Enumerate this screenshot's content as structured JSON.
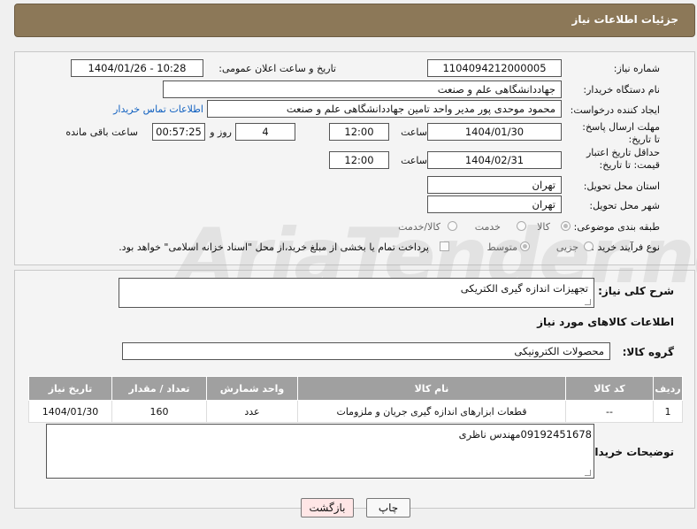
{
  "header": {
    "title": "جزئیات اطلاعات نیاز"
  },
  "fields": {
    "need_number_label": "شماره نیاز:",
    "need_number": "1104094212000005",
    "announce_label": "تاریخ و ساعت اعلان عمومی:",
    "announce_value": "1404/01/26 - 10:28",
    "buyer_label": "نام دستگاه خریدار:",
    "buyer_value": "جهاددانشگاهی علم و صنعت",
    "creator_label": "ایجاد کننده درخواست:",
    "creator_value": "محمود موحدی پور مدیر واحد تامین جهاددانشگاهی علم و صنعت",
    "contact_link": "اطلاعات تماس خریدار",
    "deadline_label": "مهلت ارسال پاسخ: تا تاریخ:",
    "deadline_date": "1404/01/30",
    "time_label": "ساعت",
    "deadline_time": "12:00",
    "days_value": "4",
    "days_label": "روز و",
    "remaining_time": "00:57:25",
    "remaining_label": "ساعت باقی مانده",
    "validity_label": "حداقل تاریخ اعتبار قیمت: تا تاریخ:",
    "validity_date": "1404/02/31",
    "validity_time": "12:00",
    "province_label": "استان محل تحویل:",
    "province_value": "تهران",
    "city_label": "شهر محل تحویل:",
    "city_value": "تهران",
    "category_label": "طبقه بندی موضوعی:",
    "category_options": [
      "کالا",
      "خدمت",
      "کالا/خدمت"
    ],
    "process_label": "نوع فرآیند خرید :",
    "process_options": [
      "جزیی",
      "متوسط"
    ],
    "payment_note": "پرداخت تمام یا بخشی از مبلغ خرید،از محل \"اسناد خزانه اسلامی\" خواهد بود."
  },
  "description": {
    "label": "شرح کلی نیاز:",
    "value": "تجهیزات اندازه گیری الکتریکی"
  },
  "goods": {
    "section_title": "اطلاعات کالاهای مورد نیاز",
    "group_label": "گروه کالا:",
    "group_value": "محصولات الکترونیکی",
    "columns": [
      "ردیف",
      "کد کالا",
      "نام کالا",
      "واحد شمارش",
      "تعداد / مقدار",
      "تاریخ نیاز"
    ],
    "rows": [
      {
        "row": "1",
        "code": "--",
        "name": "قطعات ابزارهای اندازه گیری جریان و ملزومات",
        "unit": "عدد",
        "qty": "160",
        "date": "1404/01/30"
      }
    ]
  },
  "buyer_notes": {
    "label": "توضیحات خریدار:",
    "value": "09192451678مهندس ناظری"
  },
  "buttons": {
    "print": "چاپ",
    "back": "بازگشت"
  },
  "watermark": {
    "text": "AriaTender.neT"
  }
}
